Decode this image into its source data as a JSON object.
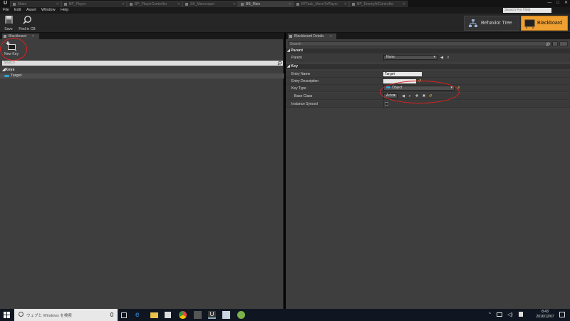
{
  "window": {
    "logo": "U",
    "tabs": [
      {
        "label": "Maim"
      },
      {
        "label": "BP_Player"
      },
      {
        "label": "BP_PlayerController"
      },
      {
        "label": "SK_Mannequin"
      },
      {
        "label": "BB_Main"
      },
      {
        "label": "BTTask_MoveToPlayer"
      },
      {
        "label": "BP_EnemyAIController"
      }
    ],
    "controls": [
      "—",
      "□",
      "✕"
    ]
  },
  "menu": {
    "items": [
      "File",
      "Edit",
      "Asset",
      "Window",
      "Help"
    ],
    "search_help": "Search For Help"
  },
  "toolbar": {
    "save_label": "Save",
    "find_label": "Find in CB",
    "mode_behavior_tree": "Behavior Tree",
    "mode_blackboard": "Blackboard"
  },
  "left_panel": {
    "tab_label": "Blackboard",
    "new_key_label": "New Key",
    "search_placeholder": "Search",
    "category": "Keys",
    "keys": [
      {
        "name": "Target"
      }
    ]
  },
  "right_panel": {
    "tab_label": "Blackboard Details",
    "search_placeholder": "Search",
    "sections": {
      "parent": {
        "title": "Parent",
        "parent_label": "Parent",
        "parent_value": "None"
      },
      "key": {
        "title": "Key",
        "entry_name_label": "Entry Name",
        "entry_name_value": "Target",
        "entry_description_label": "Entry Description",
        "entry_description_value": "",
        "key_type_label": "Key Type",
        "key_type_value": "Object",
        "base_class_label": "Base Class",
        "base_class_value": "Actor",
        "instance_synced_label": "Instance Synced"
      }
    }
  },
  "taskbar": {
    "search_placeholder": "ウェブと Windows を検索",
    "time": "8:43",
    "date": "2016/12/07"
  },
  "colors": {
    "accent_orange": "#f0a030",
    "annotation_red": "#e02020",
    "key_pill_blue": "#2fa3d6"
  }
}
